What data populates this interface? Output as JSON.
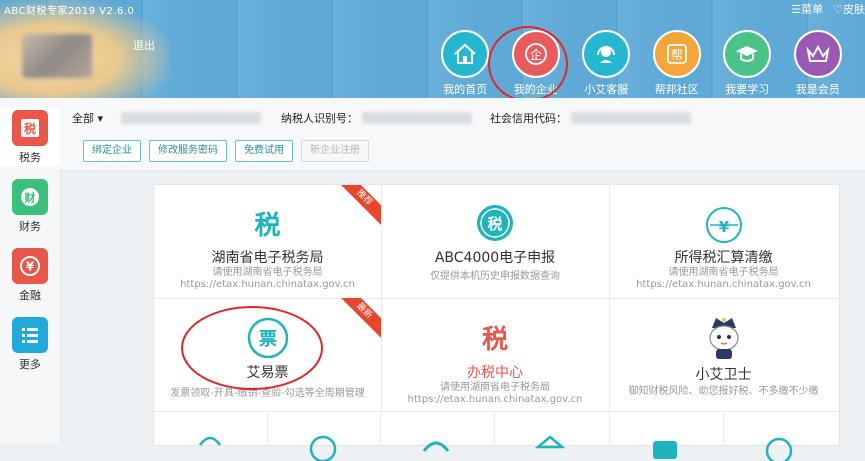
{
  "header": {
    "app_title": "ABC财税专家2019 V2.6.0",
    "menu_label": "☰菜单",
    "skin_label": "♡皮肤",
    "logout_label": "退出",
    "nav": [
      {
        "label": "我的首页",
        "icon": "home-icon",
        "color": "#25b7cf"
      },
      {
        "label": "我的企业",
        "icon": "enterprise-icon",
        "color": "#e85c5c"
      },
      {
        "label": "小艾客服",
        "icon": "headset-icon",
        "color": "#25b7cf"
      },
      {
        "label": "帮邦社区",
        "icon": "community-icon",
        "color": "#f4a63a"
      },
      {
        "label": "我要学习",
        "icon": "graduation-icon",
        "color": "#4ac38b"
      },
      {
        "label": "我是会员",
        "icon": "crown-icon",
        "color": "#9b59b6"
      }
    ]
  },
  "sidebar": {
    "items": [
      {
        "label": "税务",
        "icon": "tax-icon",
        "color": "#e8574a",
        "glyph": "税"
      },
      {
        "label": "财务",
        "icon": "finance-icon",
        "color": "#3cbf7a",
        "glyph": "财"
      },
      {
        "label": "金融",
        "icon": "yuan-icon",
        "color": "#e8574a",
        "glyph": "¥"
      },
      {
        "label": "更多",
        "icon": "list-icon",
        "color": "#21a9d9",
        "glyph": "☰"
      }
    ]
  },
  "infobar": {
    "scope_label": "全部 ▾",
    "taxpayer_id_label": "纳税人识别号：",
    "credit_code_label": "社会信用代码：",
    "buttons": [
      "绑定企业",
      "修改服务密码",
      "免费试用",
      "新企业注册"
    ]
  },
  "grid": {
    "cells": [
      {
        "title": "湖南省电子税务局",
        "sub1": "请使用湖南省电子税务局",
        "sub2": "https://etax.hunan.chinatax.gov.cn",
        "badge": "推荐",
        "icon": "tax-text-icon"
      },
      {
        "title": "ABC4000电子申报",
        "sub1": "仅提供本机历史申报数据查询",
        "sub2": "",
        "badge": "",
        "icon": "tax-circle-icon"
      },
      {
        "title": "所得税汇算清缴",
        "sub1": "请使用湖南省电子税务局",
        "sub2": "https://etax.hunan.chinatax.gov.cn",
        "badge": "",
        "icon": "yuan-circle-icon"
      },
      {
        "title": "艾易票",
        "sub1": "发票领取-开具-缴销-查验-勾选等全周期管理",
        "sub2": "",
        "badge": "最新",
        "icon": "invoice-icon"
      },
      {
        "title": "办税中心",
        "sub1": "请使用湖南省电子税务局",
        "sub2": "https://etax.hunan.chinatax.gov.cn",
        "badge": "",
        "icon": "tax-seal-icon"
      },
      {
        "title": "小艾卫士",
        "sub1": "御知财税风险、助您报好税、不多缴不少缴",
        "sub2": "",
        "badge": "",
        "icon": "guard-cat-icon"
      }
    ]
  }
}
